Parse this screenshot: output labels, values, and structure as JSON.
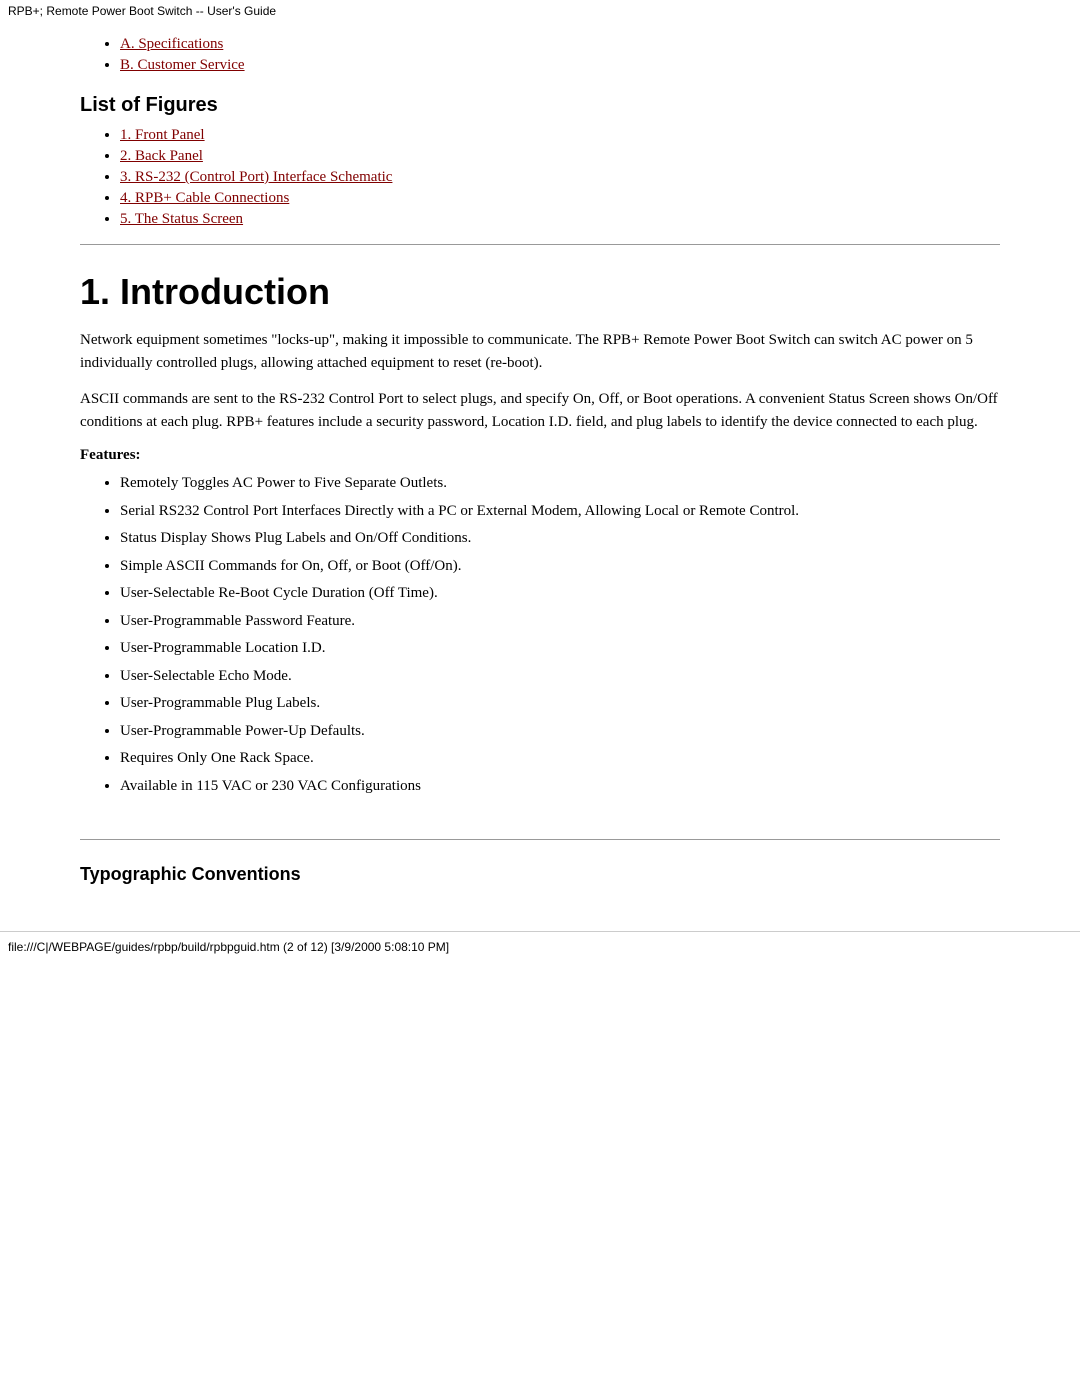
{
  "browser_header": {
    "title": "RPB+; Remote Power Boot Switch -- User's Guide"
  },
  "toc_appendix": {
    "items": [
      {
        "label": "A.  Specifications",
        "href": "#"
      },
      {
        "label": "B.  Customer Service",
        "href": "#"
      }
    ]
  },
  "list_of_figures": {
    "heading": "List of Figures",
    "items": [
      {
        "label": "1.  Front Panel",
        "href": "#"
      },
      {
        "label": "2.  Back Panel",
        "href": "#"
      },
      {
        "label": "3.  RS-232 (Control Port) Interface Schematic",
        "href": "#"
      },
      {
        "label": "4.  RPB+ Cable Connections",
        "href": "#"
      },
      {
        "label": "5.  The Status Screen",
        "href": "#"
      }
    ]
  },
  "introduction": {
    "title": "1.  Introduction",
    "paragraph1": "Network equipment sometimes \"locks-up\", making it impossible to communicate.  The RPB+ Remote Power Boot Switch can switch AC power on 5 individually controlled plugs, allowing attached equipment to reset (re-boot).",
    "paragraph2": "ASCII commands are sent to the RS-232 Control Port to select plugs, and specify On, Off, or Boot operations.  A convenient Status Screen shows On/Off conditions at each plug.  RPB+ features include a security password, Location I.D. field, and plug labels to identify the device connected to each plug.",
    "features_heading": "Features:",
    "features": [
      "Remotely Toggles AC Power to Five Separate Outlets.",
      "Serial RS232 Control Port Interfaces Directly with a PC or External Modem, Allowing Local or Remote Control.",
      "Status Display Shows Plug Labels and On/Off Conditions.",
      "Simple ASCII Commands for On, Off, or Boot (Off/On).",
      "User-Selectable Re-Boot Cycle Duration (Off Time).",
      "User-Programmable Password Feature.",
      "User-Programmable Location I.D.",
      "User-Selectable Echo Mode.",
      "User-Programmable Plug Labels.",
      "User-Programmable Power-Up Defaults.",
      "Requires Only One Rack Space.",
      "Available in 115 VAC or 230 VAC Configurations"
    ]
  },
  "typographic_conventions": {
    "heading": "Typographic Conventions"
  },
  "browser_footer": {
    "text": "file:///C|/WEBPAGE/guides/rpbp/build/rpbpguid.htm (2 of 12) [3/9/2000 5:08:10 PM]"
  }
}
